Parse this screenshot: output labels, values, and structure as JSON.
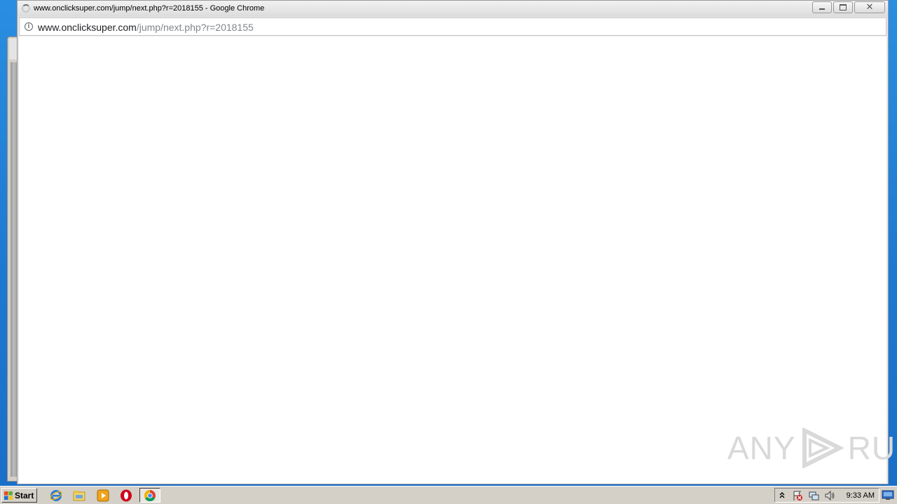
{
  "window": {
    "title": "www.onclicksuper.com/jump/next.php?r=2018155 - Google Chrome",
    "url_host": "www.onclicksuper.com",
    "url_path": "/jump/next.php?r=2018155"
  },
  "controls": {
    "minimize_icon": "minimize-icon",
    "maximize_icon": "restore-icon",
    "close_label": "✕"
  },
  "watermark": {
    "left_text": "ANY",
    "right_text": "RUN"
  },
  "taskbar": {
    "start_label": "Start",
    "pinned": [
      "internet-explorer-icon",
      "windows-explorer-icon",
      "media-player-icon",
      "opera-icon",
      "chrome-icon"
    ],
    "clock": "9:33 AM"
  },
  "colors": {
    "desktop": "#1e7fd1",
    "taskbar": "#d4d0c8",
    "url_host": "#202124",
    "url_path": "#80868b"
  }
}
